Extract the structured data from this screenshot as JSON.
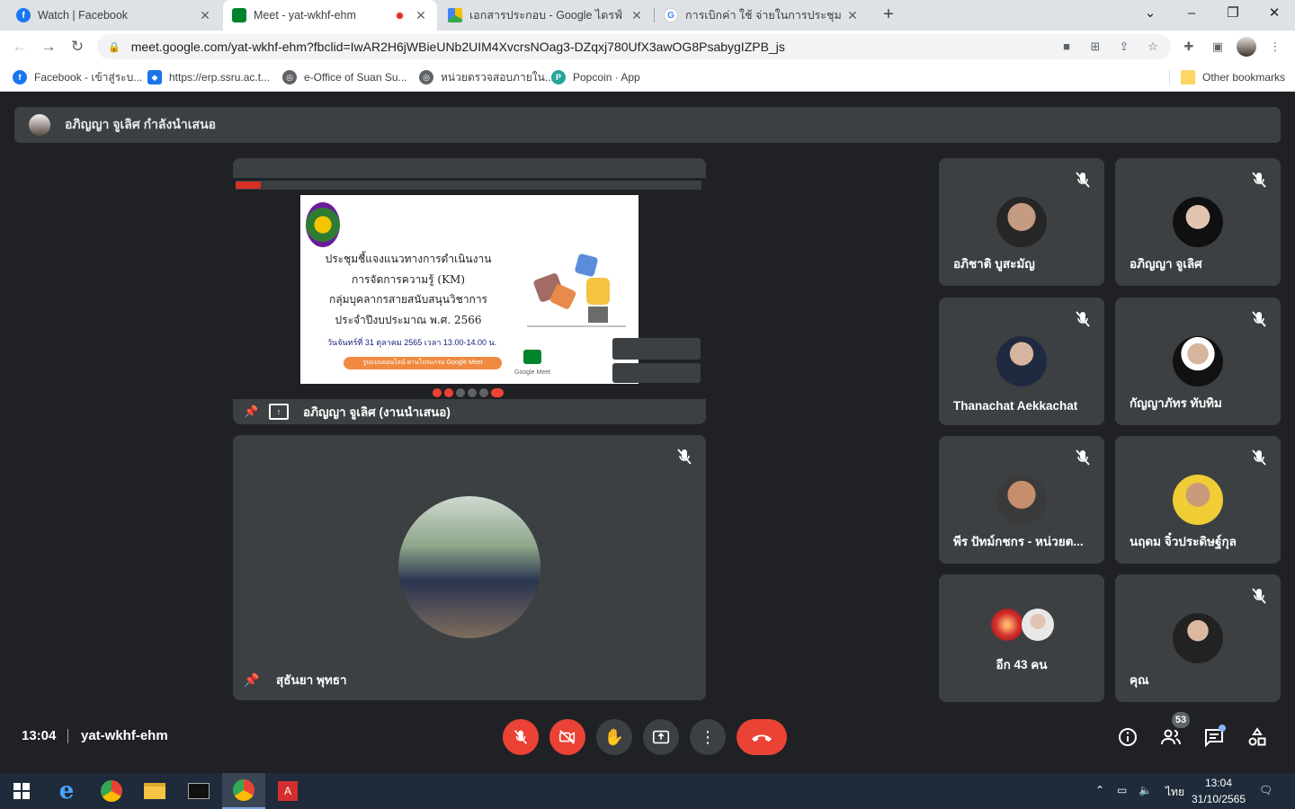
{
  "browser": {
    "tabs": [
      {
        "title": "Watch | Facebook",
        "favicon": "facebook-icon"
      },
      {
        "title": "Meet - yat-wkhf-ehm",
        "favicon": "google-meet-icon",
        "recording": true
      },
      {
        "title": "เอกสารประกอบ - Google ไดรฟ์",
        "favicon": "google-drive-icon"
      },
      {
        "title": "การเบิกค่า ใช้ จ่ายในการประชุม ออนไลน์",
        "favicon": "google-icon"
      }
    ],
    "url": "meet.google.com/yat-wkhf-ehm?fbclid=IwAR2H6jWBieUNb2UIM4XvcrsNOag3-DZqxj780UfX3awOG8PsabygIZPB_js",
    "bookmarks": [
      {
        "label": "Facebook - เข้าสู่ระบ...",
        "icon": "facebook-icon"
      },
      {
        "label": "https://erp.ssru.ac.t...",
        "icon": "shield-icon"
      },
      {
        "label": "e-Office of Suan Su...",
        "icon": "globe-icon"
      },
      {
        "label": "หน่วยตรวจสอบภายใน...",
        "icon": "globe-icon"
      },
      {
        "label": "Popcoin · App",
        "icon": "popcoin-icon"
      }
    ],
    "other_bookmarks": "Other bookmarks"
  },
  "meet": {
    "presenter_banner": "อภิญญา จูเลิศ กำลังนำเสนอ",
    "presentation": {
      "label": "อภิญญา จูเลิศ (งานนำเสนอ)",
      "slide": {
        "lines": [
          "ประชุมชี้แจงแนวทางการดำเนินงาน",
          "การจัดการความรู้ (KM)",
          "กลุ่มบุคลากรสายสนับสนุนวิชาการ",
          "ประจำปีงบประมาณ พ.ศ. 2566"
        ],
        "date": "วันจันทร์ที่ 31 ตุลาคม 2565 เวลา 13.00-14.00 น.",
        "pill": "รูปแบบออนไลน์ ผ่านโปรแกรม Google Meet",
        "logo_text": "Google Meet"
      }
    },
    "pinned_participant": "สุธันยา พุทธา",
    "participants": [
      {
        "name": "อภิชาติ บูสะมัญ"
      },
      {
        "name": "อภิญญา จูเลิศ"
      },
      {
        "name": "Thanachat Aekkachat"
      },
      {
        "name": "กัญญาภัทร ทับทิม"
      },
      {
        "name": "พีร ปัทม์กชกร - หน่วยต..."
      },
      {
        "name": "นฤดม จิ๋วประดิษฐ์กุล"
      },
      {
        "name": "คุณ"
      }
    ],
    "more_people": "อีก 43 คน",
    "meeting_time": "13:04",
    "meeting_code": "yat-wkhf-ehm",
    "people_count": "53",
    "colors": {
      "end_call": "#ea4335",
      "tile": "#3c4043",
      "background": "#202124"
    }
  },
  "taskbar": {
    "language": "ไทย",
    "time": "13:04",
    "date": "31/10/2565"
  }
}
